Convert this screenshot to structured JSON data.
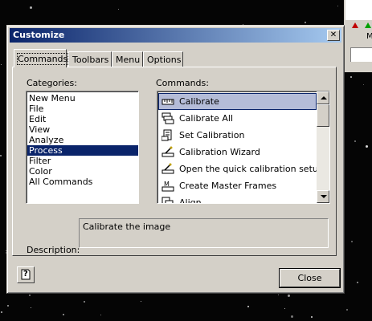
{
  "dialog": {
    "title": "Customize",
    "close_glyph": "✕",
    "tabs": [
      {
        "label": "Commands",
        "active": true
      },
      {
        "label": "Toolbars",
        "active": false
      },
      {
        "label": "Menu",
        "active": false
      },
      {
        "label": "Options",
        "active": false
      }
    ],
    "categories_label": "Categories:",
    "commands_label": "Commands:",
    "categories": [
      "New Menu",
      "File",
      "Edit",
      "View",
      "Analyze",
      "Process",
      "Filter",
      "Color",
      "All Commands"
    ],
    "selected_category": "Process",
    "commands": [
      {
        "label": "Calibrate",
        "icon": "calibrate-icon",
        "selected": true
      },
      {
        "label": "Calibrate All",
        "icon": "calibrate-all-icon"
      },
      {
        "label": "Set Calibration",
        "icon": "set-calibration-icon"
      },
      {
        "label": "Calibration Wizard",
        "icon": "calibration-wizard-icon"
      },
      {
        "label": "Open the quick calibration setup wiz",
        "icon": "quick-calibration-icon"
      },
      {
        "label": "Create Master Frames",
        "icon": "master-frames-icon"
      },
      {
        "label": "Align",
        "icon": "align-icon"
      }
    ],
    "description_label": "Description:",
    "description_text": "Calibrate the image",
    "help_glyph": "?",
    "close_button": "Close"
  },
  "background_toolbar": {
    "label": "M"
  },
  "colors": {
    "title_gradient_start": "#0a246a",
    "title_gradient_end": "#a6caf0",
    "selection": "#0a246a",
    "face": "#d4d0c8"
  }
}
